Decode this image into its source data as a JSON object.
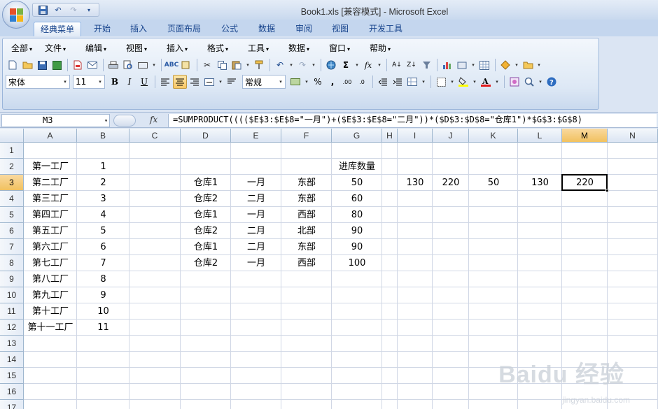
{
  "window": {
    "title": "Book1.xls  [兼容模式] - Microsoft Excel"
  },
  "qat": {
    "undo_label": "↶",
    "redo_label": "↷"
  },
  "ribbon_tabs": [
    "经典菜单",
    "开始",
    "插入",
    "页面布局",
    "公式",
    "数据",
    "审阅",
    "视图",
    "开发工具"
  ],
  "active_tab": "经典菜单",
  "menus": [
    "全部",
    "文件",
    "编辑",
    "视图",
    "插入",
    "格式",
    "工具",
    "数据",
    "窗口",
    "帮助"
  ],
  "toolbar": {
    "font_name": "宋体",
    "font_size": "11",
    "number_format": "常规",
    "bold": "B",
    "italic": "I",
    "underline": "U"
  },
  "formula_bar": {
    "name_box": "M3",
    "fx": "fx",
    "formula": "=SUMPRODUCT(((($E$3:$E$8=\"一月\")+($E$3:$E$8=\"二月\"))*($D$3:$D$8=\"仓库1\")*$G$3:$G$8)"
  },
  "columns": [
    "A",
    "B",
    "C",
    "D",
    "E",
    "F",
    "G",
    "H",
    "I",
    "J",
    "K",
    "L",
    "M",
    "N"
  ],
  "selected_column": "M",
  "rows": [
    "1",
    "2",
    "3",
    "4",
    "5",
    "6",
    "7",
    "8",
    "9",
    "10",
    "11",
    "12",
    "13",
    "14",
    "15",
    "16",
    "17"
  ],
  "selected_row": "3",
  "cells": {
    "A2": "第一工厂",
    "B2": "1",
    "G2": "进库数量",
    "A3": "第二工厂",
    "B3": "2",
    "D3": "仓库1",
    "E3": "一月",
    "F3": "东部",
    "G3": "50",
    "I3": "130",
    "J3": "220",
    "K3": "50",
    "L3": "130",
    "M3": "220",
    "A4": "第三工厂",
    "B4": "3",
    "D4": "仓库2",
    "E4": "二月",
    "F4": "东部",
    "G4": "60",
    "A5": "第四工厂",
    "B5": "4",
    "D5": "仓库1",
    "E5": "一月",
    "F5": "西部",
    "G5": "80",
    "A6": "第五工厂",
    "B6": "5",
    "D6": "仓库2",
    "E6": "二月",
    "F6": "北部",
    "G6": "90",
    "A7": "第六工厂",
    "B7": "6",
    "D7": "仓库1",
    "E7": "二月",
    "F7": "东部",
    "G7": "90",
    "A8": "第七工厂",
    "B8": "7",
    "D8": "仓库2",
    "E8": "一月",
    "F8": "西部",
    "G8": "100",
    "A9": "第八工厂",
    "B9": "8",
    "A10": "第九工厂",
    "B10": "9",
    "A11": "第十工厂",
    "B11": "10",
    "A12": "第十一工厂",
    "B12": "11"
  },
  "watermark": {
    "brand": "Baidu 经验",
    "url": "jingyan.baidu.com"
  }
}
